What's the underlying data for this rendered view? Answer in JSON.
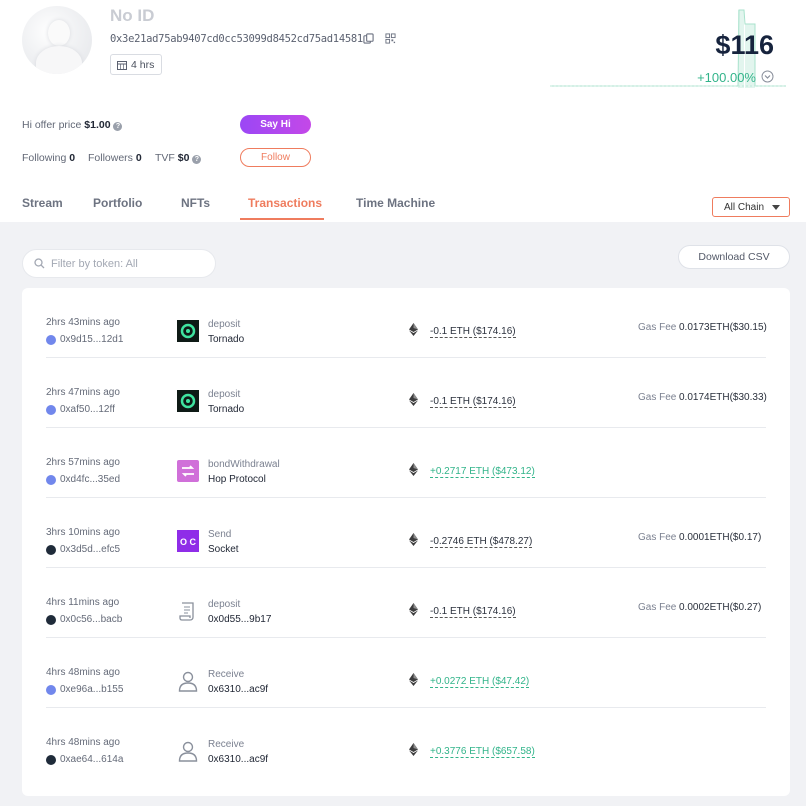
{
  "profile": {
    "name": "No ID",
    "address": "0x3e21ad75ab9407cd0cc53099d8452cd75ad14581",
    "age": "4 hrs",
    "balance": "$116",
    "change": "+100.00%",
    "change_color": "#32b48a"
  },
  "info": {
    "hi_offer_label": "Hi offer price",
    "hi_offer_value": "$1.00",
    "following_label": "Following",
    "following_value": "0",
    "followers_label": "Followers",
    "followers_value": "0",
    "tvf_label": "TVF",
    "tvf_value": "$0",
    "say_hi_label": "Say Hi",
    "follow_label": "Follow"
  },
  "tabs": [
    {
      "label": "Stream"
    },
    {
      "label": "Portfolio"
    },
    {
      "label": "NFTs"
    },
    {
      "label": "Transactions",
      "active": true
    },
    {
      "label": "Time Machine"
    }
  ],
  "chain_filter": "All Chain",
  "filter_placeholder": "Filter by token: All",
  "download_label": "Download CSV",
  "accent_color": "#ef7c5e",
  "transactions": [
    {
      "time": "2hrs 43mins ago",
      "hash": "0x9d15...12d1",
      "chain": "eth",
      "icon": "tornado-icon",
      "action": "deposit",
      "party": "Tornado",
      "amount": "-0.1 ETH ($174.16)",
      "direction": "neg",
      "gas_label": "Gas Fee",
      "gas": "0.0173ETH($30.15)"
    },
    {
      "time": "2hrs 47mins ago",
      "hash": "0xaf50...12ff",
      "chain": "eth",
      "icon": "tornado-icon",
      "action": "deposit",
      "party": "Tornado",
      "amount": "-0.1 ETH ($174.16)",
      "direction": "neg",
      "gas_label": "Gas Fee",
      "gas": "0.0174ETH($30.33)"
    },
    {
      "time": "2hrs 57mins ago",
      "hash": "0xd4fc...35ed",
      "chain": "eth",
      "icon": "hop-protocol-icon",
      "action": "bondWithdrawal",
      "party": "Hop Protocol",
      "amount": "+0.2717 ETH ($473.12)",
      "direction": "pos",
      "gas_label": "",
      "gas": ""
    },
    {
      "time": "3hrs 10mins ago",
      "hash": "0x3d5d...efc5",
      "chain": "arb",
      "icon": "socket-icon",
      "action": "Send",
      "party": "Socket",
      "amount": "-0.2746 ETH ($478.27)",
      "direction": "neg",
      "gas_label": "Gas Fee",
      "gas": "0.0001ETH($0.17)"
    },
    {
      "time": "4hrs 11mins ago",
      "hash": "0x0c56...bacb",
      "chain": "arb",
      "icon": "contract-icon",
      "action": "deposit",
      "party": "0x0d55...9b17",
      "amount": "-0.1 ETH ($174.16)",
      "direction": "neg",
      "gas_label": "Gas Fee",
      "gas": "0.0002ETH($0.27)"
    },
    {
      "time": "4hrs 48mins ago",
      "hash": "0xe96a...b155",
      "chain": "eth",
      "icon": "user-icon",
      "action": "Receive",
      "party": "0x6310...ac9f",
      "amount": "+0.0272 ETH ($47.42)",
      "direction": "pos",
      "gas_label": "",
      "gas": ""
    },
    {
      "time": "4hrs 48mins ago",
      "hash": "0xae64...614a",
      "chain": "arb",
      "icon": "user-icon",
      "action": "Receive",
      "party": "0x6310...ac9f",
      "amount": "+0.3776 ETH ($657.58)",
      "direction": "pos",
      "gas_label": "",
      "gas": ""
    }
  ]
}
